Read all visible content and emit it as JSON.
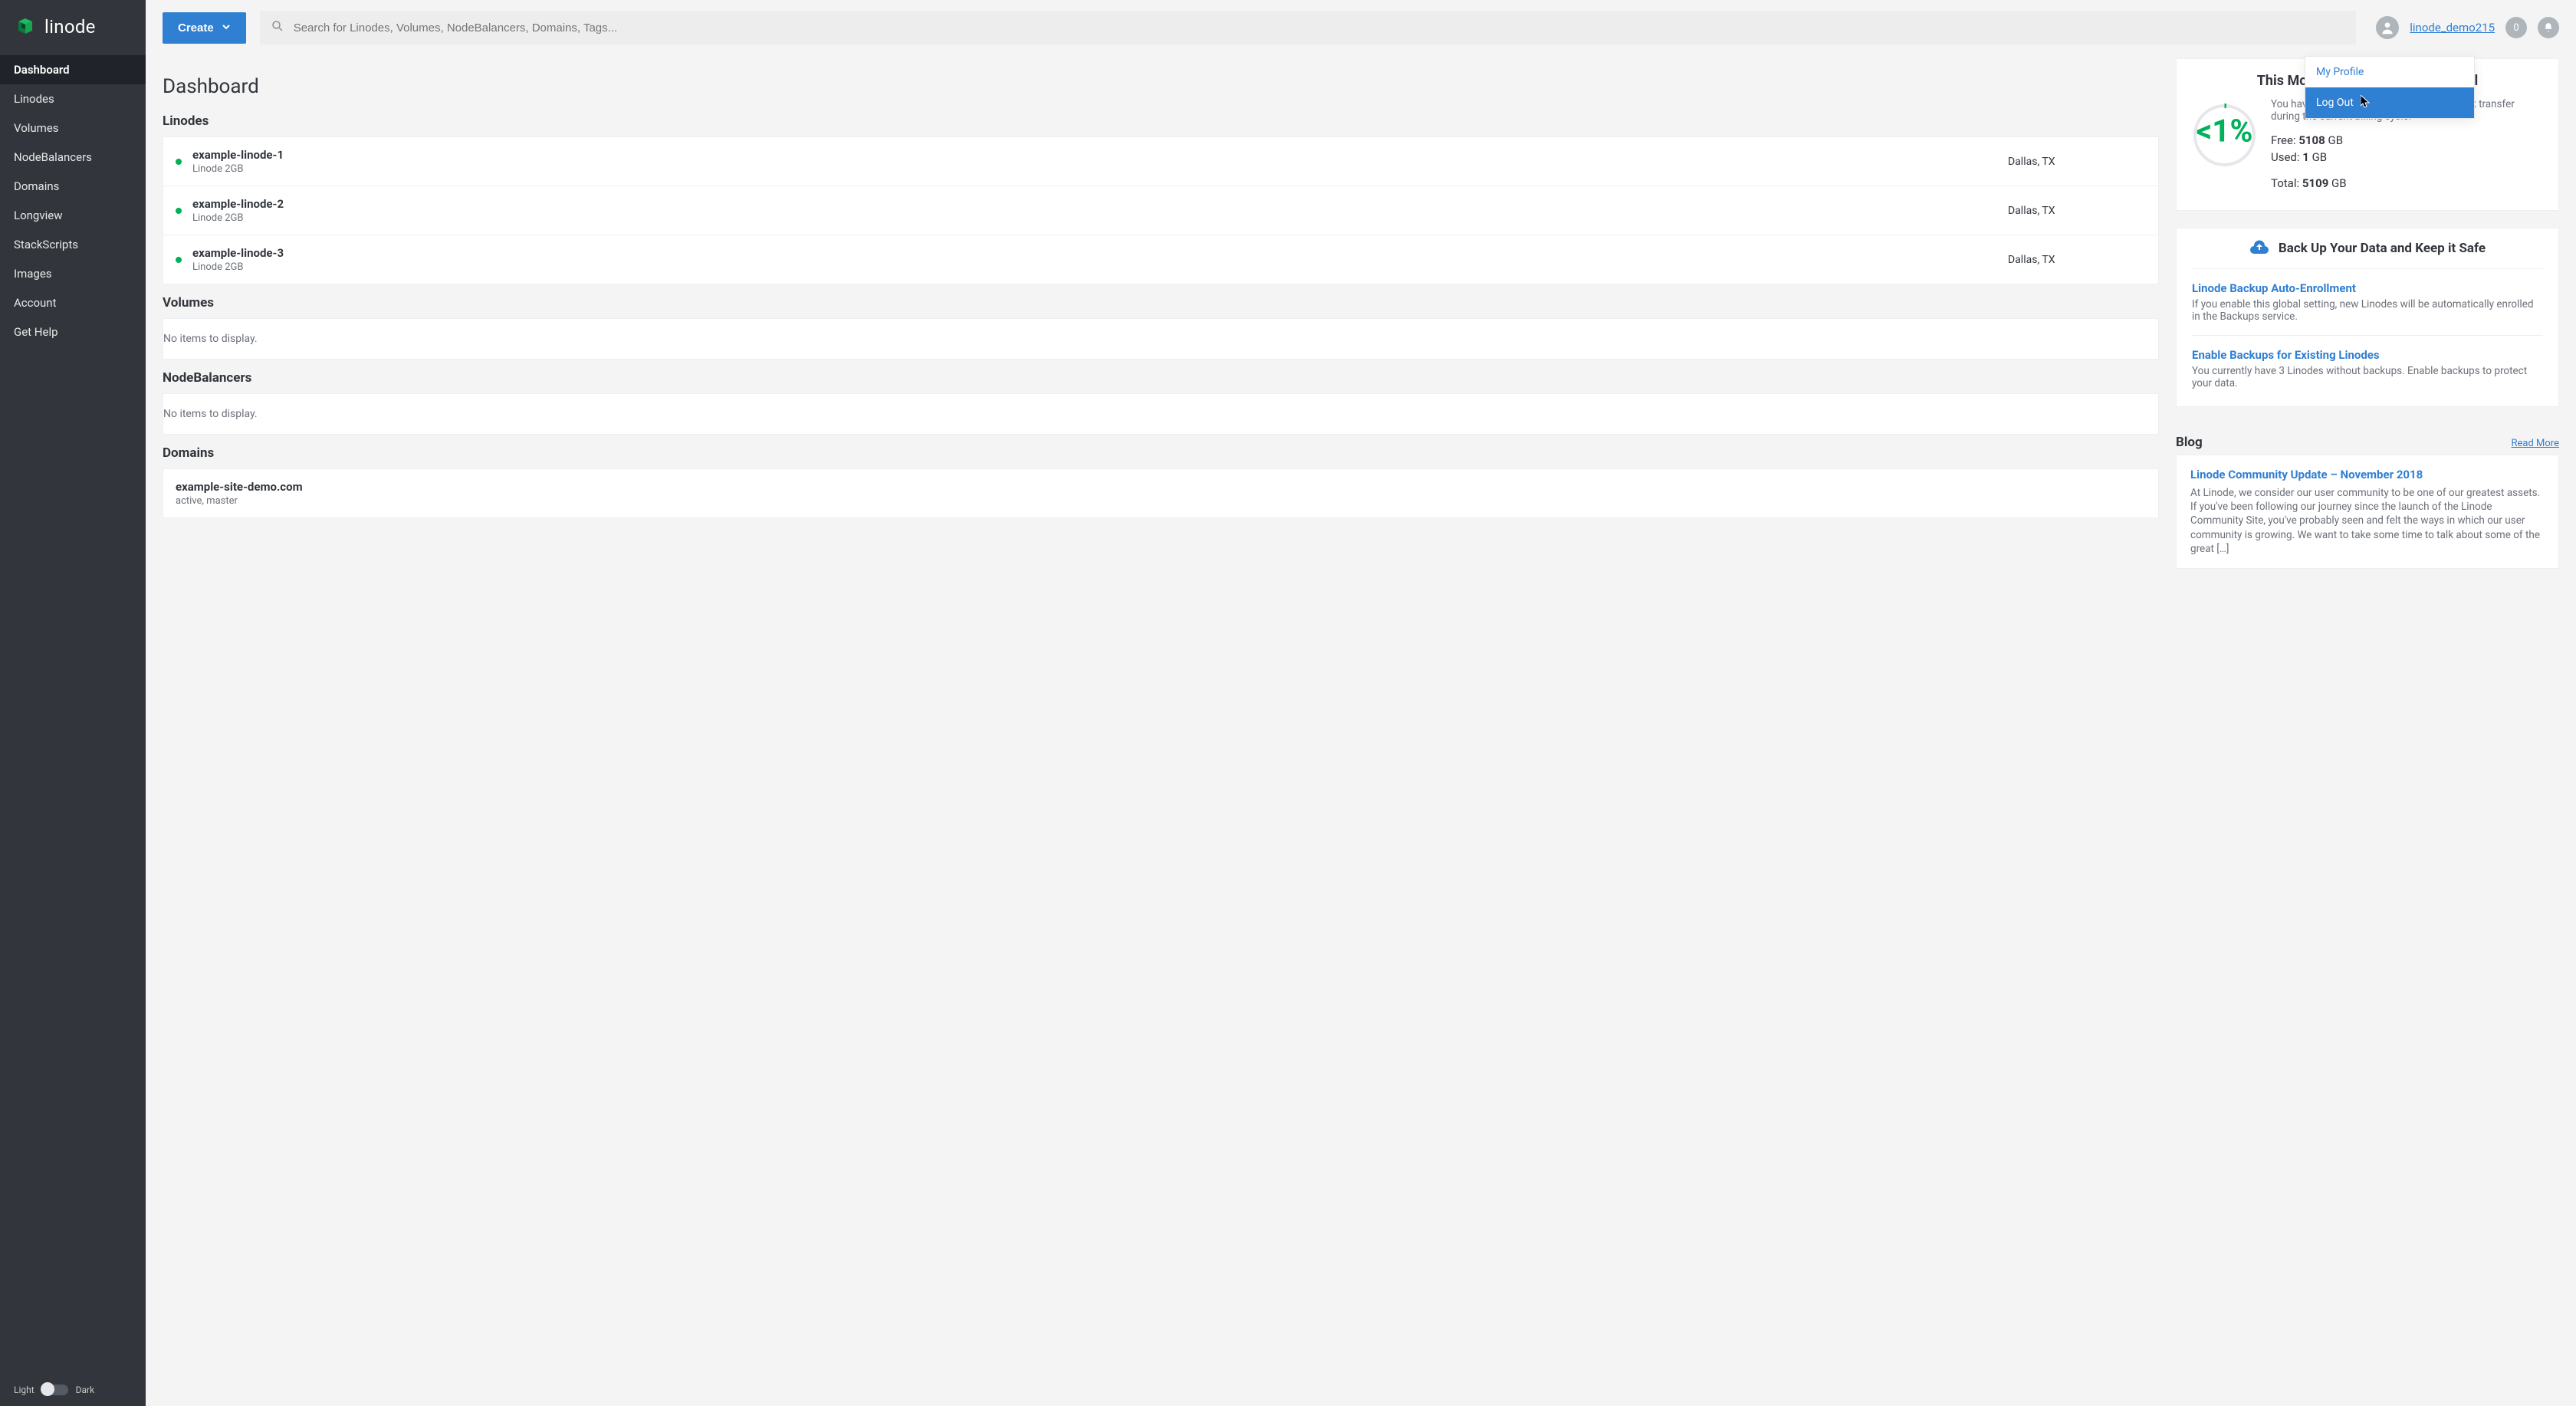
{
  "brand": {
    "name": "linode"
  },
  "sidebar": {
    "items": [
      "Dashboard",
      "Linodes",
      "Volumes",
      "NodeBalancers",
      "Domains",
      "Longview",
      "StackScripts",
      "Images",
      "Account",
      "Get Help"
    ],
    "activeIndex": 0,
    "theme": {
      "light": "Light",
      "dark": "Dark"
    }
  },
  "topbar": {
    "create_label": "Create",
    "search_placeholder": "Search for Linodes, Volumes, NodeBalancers, Domains, Tags...",
    "username": "linode_demo215",
    "notification_count": "0"
  },
  "user_menu": {
    "profile": "My Profile",
    "logout": "Log Out"
  },
  "page": {
    "title": "Dashboard"
  },
  "sections": {
    "linodes": {
      "title": "Linodes",
      "rows": [
        {
          "name": "example-linode-1",
          "plan": "Linode 2GB",
          "region": "Dallas, TX"
        },
        {
          "name": "example-linode-2",
          "plan": "Linode 2GB",
          "region": "Dallas, TX"
        },
        {
          "name": "example-linode-3",
          "plan": "Linode 2GB",
          "region": "Dallas, TX"
        }
      ]
    },
    "volumes": {
      "title": "Volumes",
      "empty": "No items to display."
    },
    "nodebalancers": {
      "title": "NodeBalancers",
      "empty": "No items to display."
    },
    "domains": {
      "title": "Domains",
      "rows": [
        {
          "name": "example-site-demo.com",
          "sub": "active, master"
        }
      ]
    }
  },
  "transfer": {
    "title": "This Month's Network Transfer Pool",
    "desc": "You have used <1% of your available network transfer during the current billing cycle.",
    "percent_label": "<1%",
    "free": {
      "label": "Free:",
      "value": "5108",
      "unit": " GB"
    },
    "used": {
      "label": "Used:",
      "value": "1",
      "unit": " GB"
    },
    "total": {
      "label": "Total:",
      "value": "5109",
      "unit": " GB"
    }
  },
  "backup": {
    "header_title": "Back Up Your Data and Keep it Safe",
    "items": [
      {
        "title": "Linode Backup Auto-Enrollment",
        "desc": "If you enable this global setting, new Linodes will be automatically enrolled in the Backups service."
      },
      {
        "title": "Enable Backups for Existing Linodes",
        "desc": "You currently have 3 Linodes without backups. Enable backups to protect your data."
      }
    ]
  },
  "blog": {
    "title": "Blog",
    "read_more": "Read More",
    "post": {
      "title": "Linode Community Update – November 2018",
      "desc": "At Linode, we consider our user community to be one of our greatest assets. If you've been following our journey since the launch of the Linode Community Site, you've probably seen and felt the ways in which our user community is growing. We want to take some time to talk about some of the great […]"
    }
  }
}
